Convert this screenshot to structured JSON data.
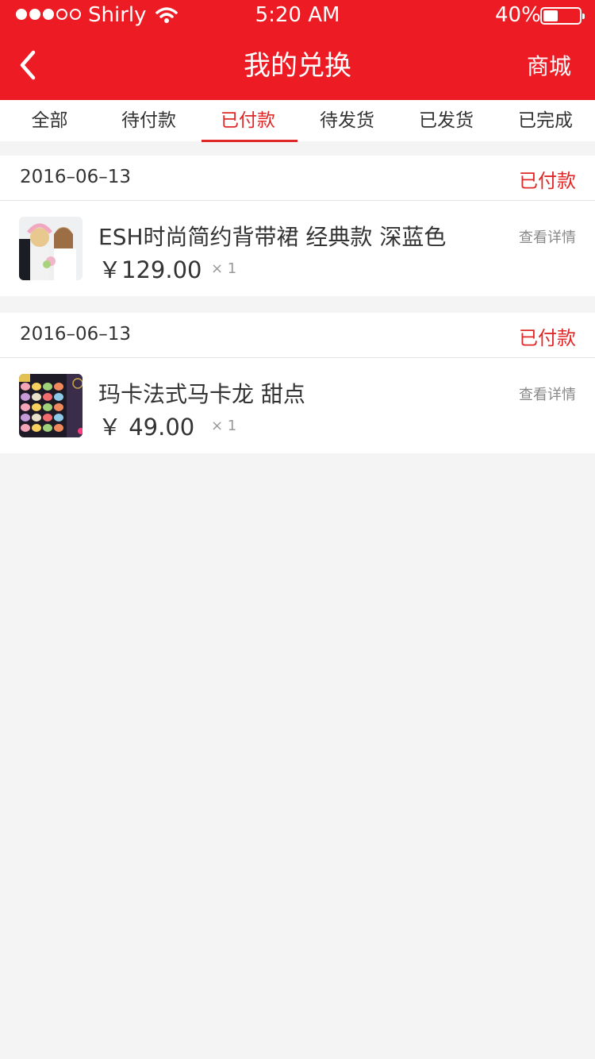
{
  "status_bar": {
    "carrier": "Shirly",
    "time": "5:20 AM",
    "battery": "40%",
    "signal_bars_filled": 3,
    "signal_bars_total": 5
  },
  "nav": {
    "title": "我的兑换",
    "right_action": "商城",
    "back_icon": "chevron-left-icon"
  },
  "tabs": [
    {
      "label": "全部",
      "active": false
    },
    {
      "label": "待付款",
      "active": false
    },
    {
      "label": "已付款",
      "active": true
    },
    {
      "label": "待发货",
      "active": false
    },
    {
      "label": "已发货",
      "active": false
    },
    {
      "label": "已完成",
      "active": false
    }
  ],
  "orders": [
    {
      "date": "2016–06–13",
      "status": "已付款",
      "item": {
        "name": "ESH时尚简约背带裙 经典款 深蓝色",
        "price": "￥129.00",
        "qty": "× 1",
        "detail": "查看详情",
        "thumb": "dress-photo"
      }
    },
    {
      "date": "2016–06–13",
      "status": "已付款",
      "item": {
        "name": "玛卡法式马卡龙 甜点",
        "price": "￥ 49.00",
        "qty": "× 1",
        "detail": "查看详情",
        "thumb": "macaron-box-photo"
      }
    }
  ],
  "colors": {
    "brand_red": "#ed1c24",
    "accent_red": "#e02828",
    "background": "#f4f4f4"
  }
}
